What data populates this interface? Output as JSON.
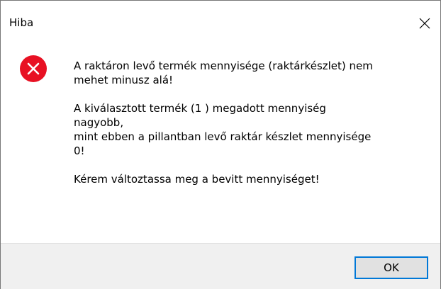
{
  "window": {
    "title": "Hiba",
    "close_icon": "close-icon"
  },
  "dialog": {
    "icon": "error-icon",
    "icon_color": "#e81123",
    "message_lines": [
      "A raktáron levő termék mennyisége (raktárkészlet) nem",
      "mehet minusz alá!",
      "",
      "A kiválasztott termék (1 ) megadott mennyiség",
      "nagyobb,",
      "mint ebben a pillantban levő raktár készlet mennyisége",
      "0!",
      "",
      "Kérem változtassa meg a bevitt mennyiséget!"
    ]
  },
  "buttons": {
    "ok_label": "OK"
  },
  "colors": {
    "footer_bg": "#f0f0f0",
    "button_focus_border": "#0078d7",
    "button_bg": "#e1e1e1"
  }
}
